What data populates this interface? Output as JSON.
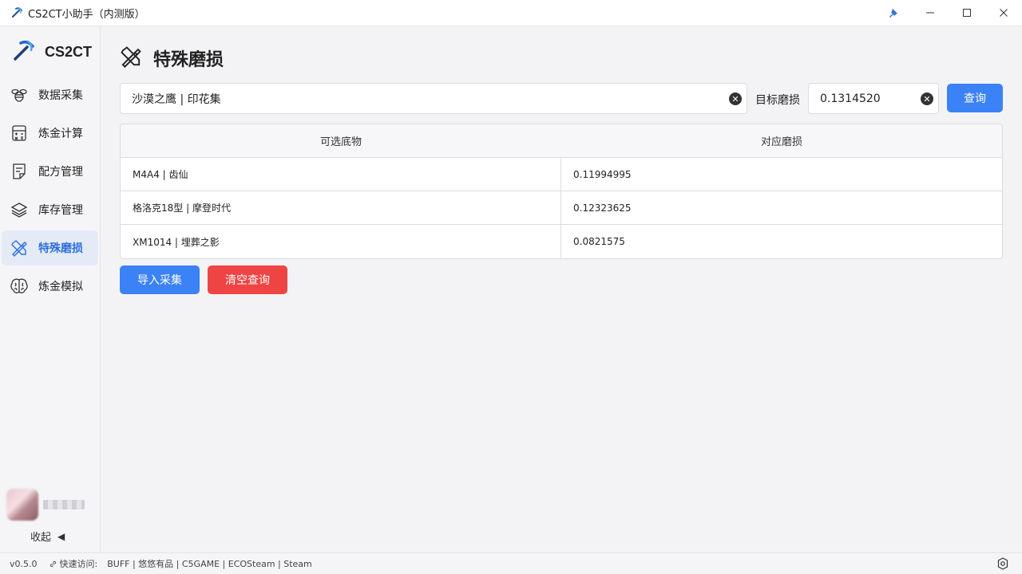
{
  "window": {
    "title": "CS2CT小助手（内测版）",
    "icon": "pickaxe-icon",
    "controls": [
      "pin-icon",
      "minimize-icon",
      "maximize-icon",
      "close-icon"
    ]
  },
  "sidebar": {
    "brand": "CS2CT",
    "items": [
      {
        "label": "数据采集",
        "icon": "bee-icon",
        "active": false
      },
      {
        "label": "炼金计算",
        "icon": "calculator-icon",
        "active": false
      },
      {
        "label": "配方管理",
        "icon": "document-icon",
        "active": false
      },
      {
        "label": "库存管理",
        "icon": "layers-icon",
        "active": false
      },
      {
        "label": "特殊磨损",
        "icon": "tools-icon",
        "active": true
      },
      {
        "label": "炼金模拟",
        "icon": "brain-icon",
        "active": false
      }
    ],
    "collapse_label": "收起",
    "collapse_glyph": "◀"
  },
  "page": {
    "title": "特殊磨损",
    "search_value": "沙漠之鹰 | 印花集",
    "target_label": "目标磨损",
    "target_value": "0.1314520",
    "query_button": "查询",
    "import_button": "导入采集",
    "clear_button": "清空查询"
  },
  "table": {
    "columns": [
      "可选底物",
      "对应磨损"
    ],
    "rows": [
      {
        "item": "M4A4 | 齿仙",
        "wear": "0.11994995"
      },
      {
        "item": "格洛克18型 | 摩登时代",
        "wear": "0.12323625"
      },
      {
        "item": "XM1014 | 埋葬之影",
        "wear": "0.0821575"
      }
    ]
  },
  "statusbar": {
    "version": "v0.5.0",
    "quick_label": "快速访问:",
    "links": "BUFF | 悠悠有品 | C5GAME | ECOSteam | Steam"
  },
  "colors": {
    "accent": "#3b82f6",
    "danger": "#ef4444",
    "active_bg": "#e4ebf7",
    "active_text": "#2f6fdd"
  }
}
